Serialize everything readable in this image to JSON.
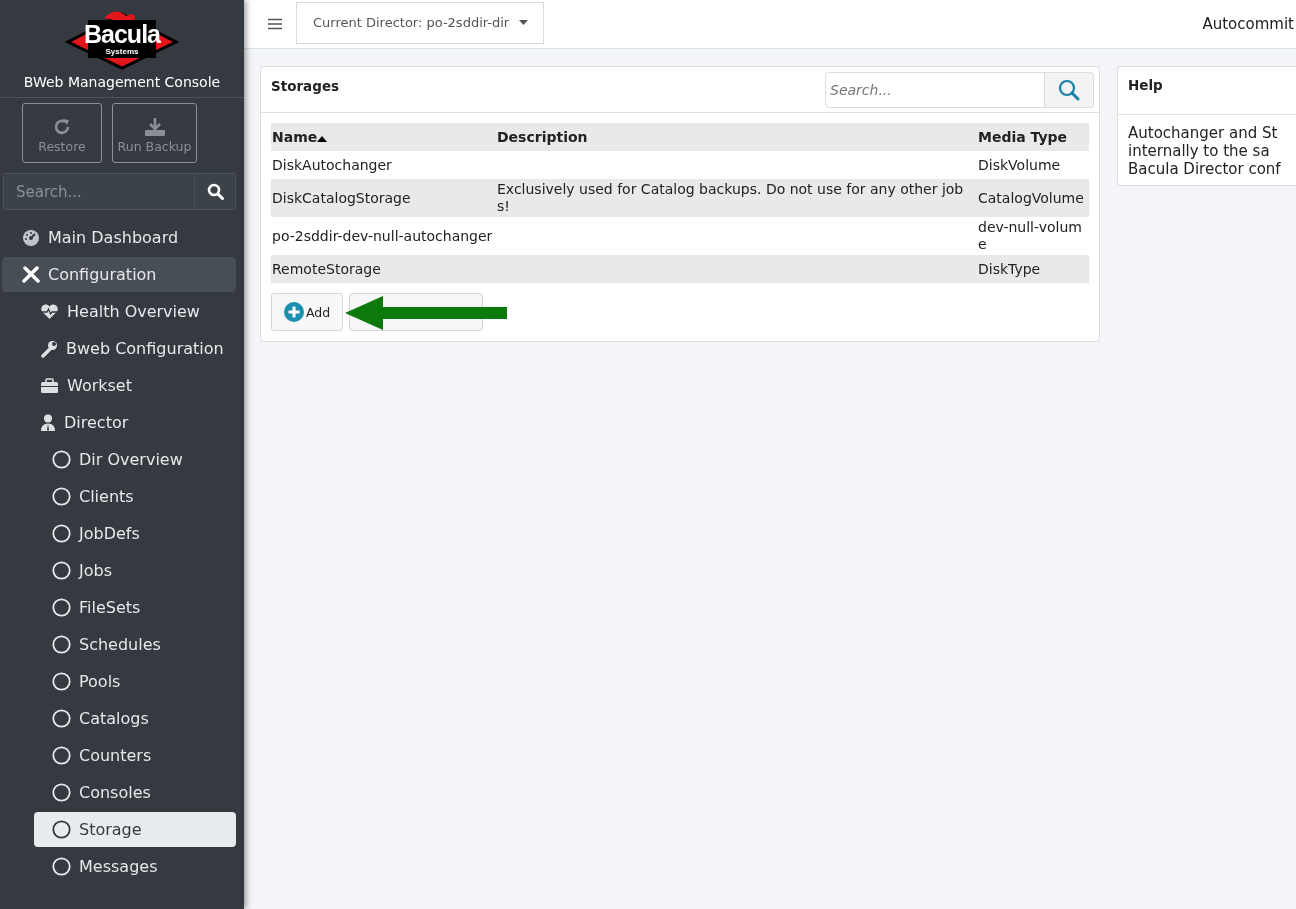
{
  "sidebar": {
    "logo": {
      "wordmark": "Bacula",
      "tagline": "Systems"
    },
    "title": "BWeb Management Console",
    "actions": [
      {
        "label": "Restore",
        "disabled": true
      },
      {
        "label": "Run Backup",
        "disabled": true
      }
    ],
    "search": {
      "placeholder": "Search..."
    },
    "items": [
      {
        "label": "Main Dashboard",
        "selected": false
      },
      {
        "label": "Configuration",
        "selected": true,
        "expanded": true,
        "children": [
          {
            "label": "Health Overview",
            "selected": false
          },
          {
            "label": "Bweb Configuration",
            "selected": false
          },
          {
            "label": "Workset",
            "selected": false
          },
          {
            "label": "Director",
            "selected": false,
            "expanded": true,
            "children": [
              {
                "label": "Dir Overview",
                "selected": false
              },
              {
                "label": "Clients",
                "selected": false
              },
              {
                "label": "JobDefs",
                "selected": false
              },
              {
                "label": "Jobs",
                "selected": false
              },
              {
                "label": "FileSets",
                "selected": false
              },
              {
                "label": "Schedules",
                "selected": false
              },
              {
                "label": "Pools",
                "selected": false
              },
              {
                "label": "Catalogs",
                "selected": false
              },
              {
                "label": "Counters",
                "selected": false
              },
              {
                "label": "Consoles",
                "selected": false
              },
              {
                "label": "Storage",
                "selected": true
              },
              {
                "label": "Messages",
                "selected": false
              }
            ]
          }
        ]
      }
    ]
  },
  "topbar": {
    "director": "Current Director: po-2sddir-dir",
    "right_text": "Autocommit"
  },
  "storages": {
    "title": "Storages",
    "search": {
      "placeholder": "Search..."
    },
    "table": {
      "columns": [
        {
          "label": "Name",
          "sorted_ascending": true
        },
        {
          "label": "Description"
        },
        {
          "label": "Media Type"
        }
      ],
      "rows": [
        [
          "DiskAutochanger",
          "",
          "DiskVolume"
        ],
        [
          "DiskCatalogStorage",
          "Exclusively used for Catalog backups. Do not use for any other jobs!",
          "CatalogVolume"
        ],
        [
          "po-2sddir-dev-null-autochanger",
          "",
          "dev-null-volume"
        ],
        [
          "RemoteStorage",
          "",
          "DiskType"
        ]
      ]
    },
    "buttons": [
      {
        "label": "Add",
        "kind": "add"
      },
      {
        "kind": "covered"
      }
    ]
  },
  "help": {
    "title": "Help",
    "lines": [
      "Autochanger and St",
      "internally to the sa",
      "Bacula Director conf"
    ]
  }
}
